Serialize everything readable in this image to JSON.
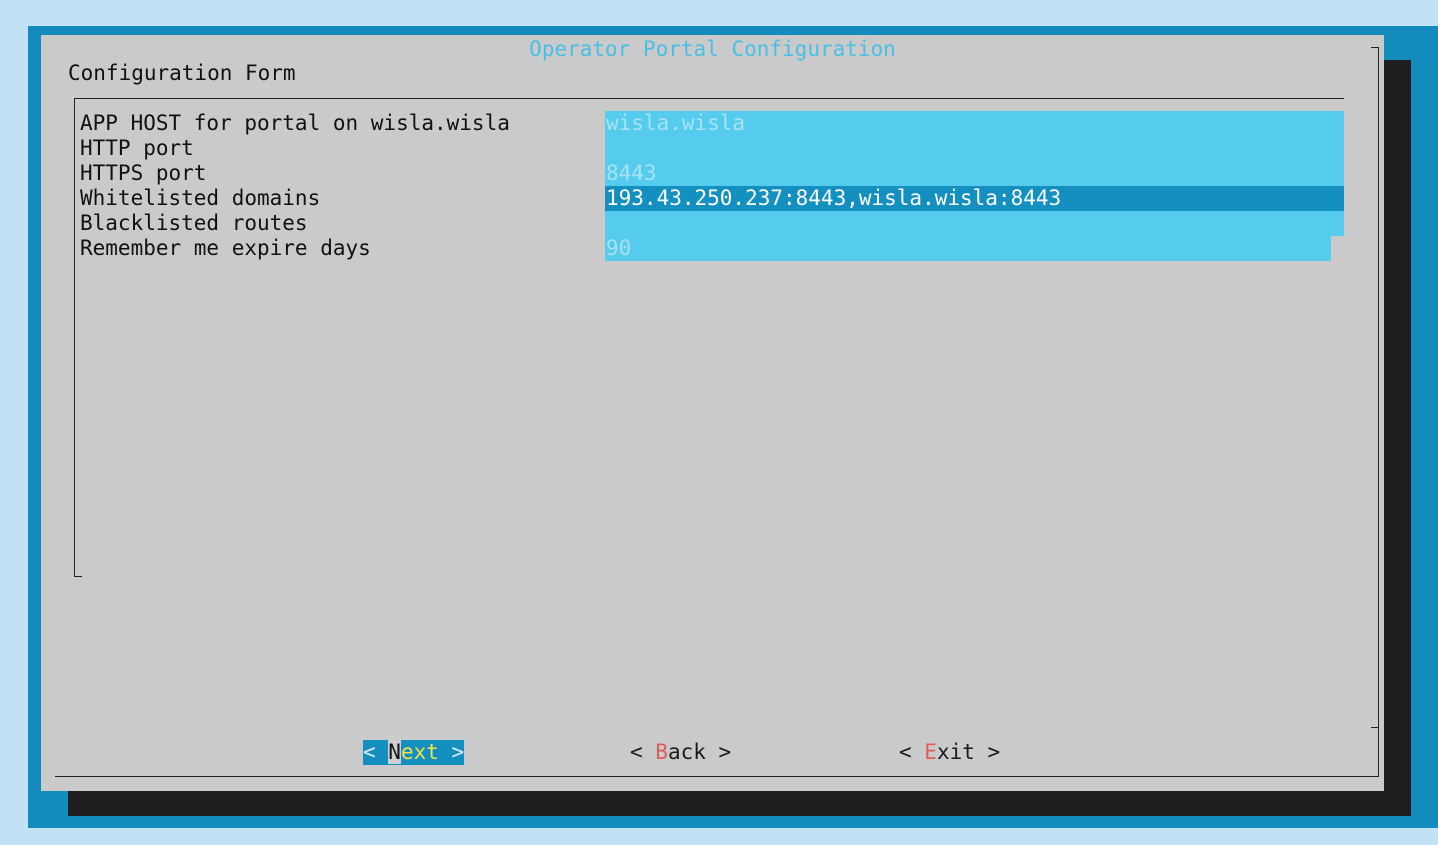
{
  "dialog": {
    "title": "Operator Portal Configuration",
    "form_title": "Configuration Form"
  },
  "fields": [
    {
      "label": "APP HOST for portal on wisla.wisla",
      "value": "wisla.wisla"
    },
    {
      "label": "HTTP port",
      "value": ""
    },
    {
      "label": "HTTPS port",
      "value": "8443"
    },
    {
      "label": "Whitelisted domains",
      "value": "193.43.250.237:8443,wisla.wisla:8443"
    },
    {
      "label": "Blacklisted routes",
      "value": ""
    },
    {
      "label": "Remember me expire days",
      "value": "90"
    }
  ],
  "buttons": {
    "next": {
      "open": "< ",
      "first": "N",
      "rest": "ext",
      "close": " >"
    },
    "back": {
      "open": "< ",
      "hot": "B",
      "rest": "ack",
      "close": " >"
    },
    "exit": {
      "open": "< ",
      "hot": "E",
      "rest": "xit",
      "close": " >"
    }
  },
  "colors": {
    "screen_bg": "#138cbd",
    "dialog_bg": "#cacaca",
    "field_bg": "#55cbee",
    "active_field_bg": "#1390c0",
    "title_color": "#49bfe6",
    "hotkey_color": "#e05c5c"
  }
}
